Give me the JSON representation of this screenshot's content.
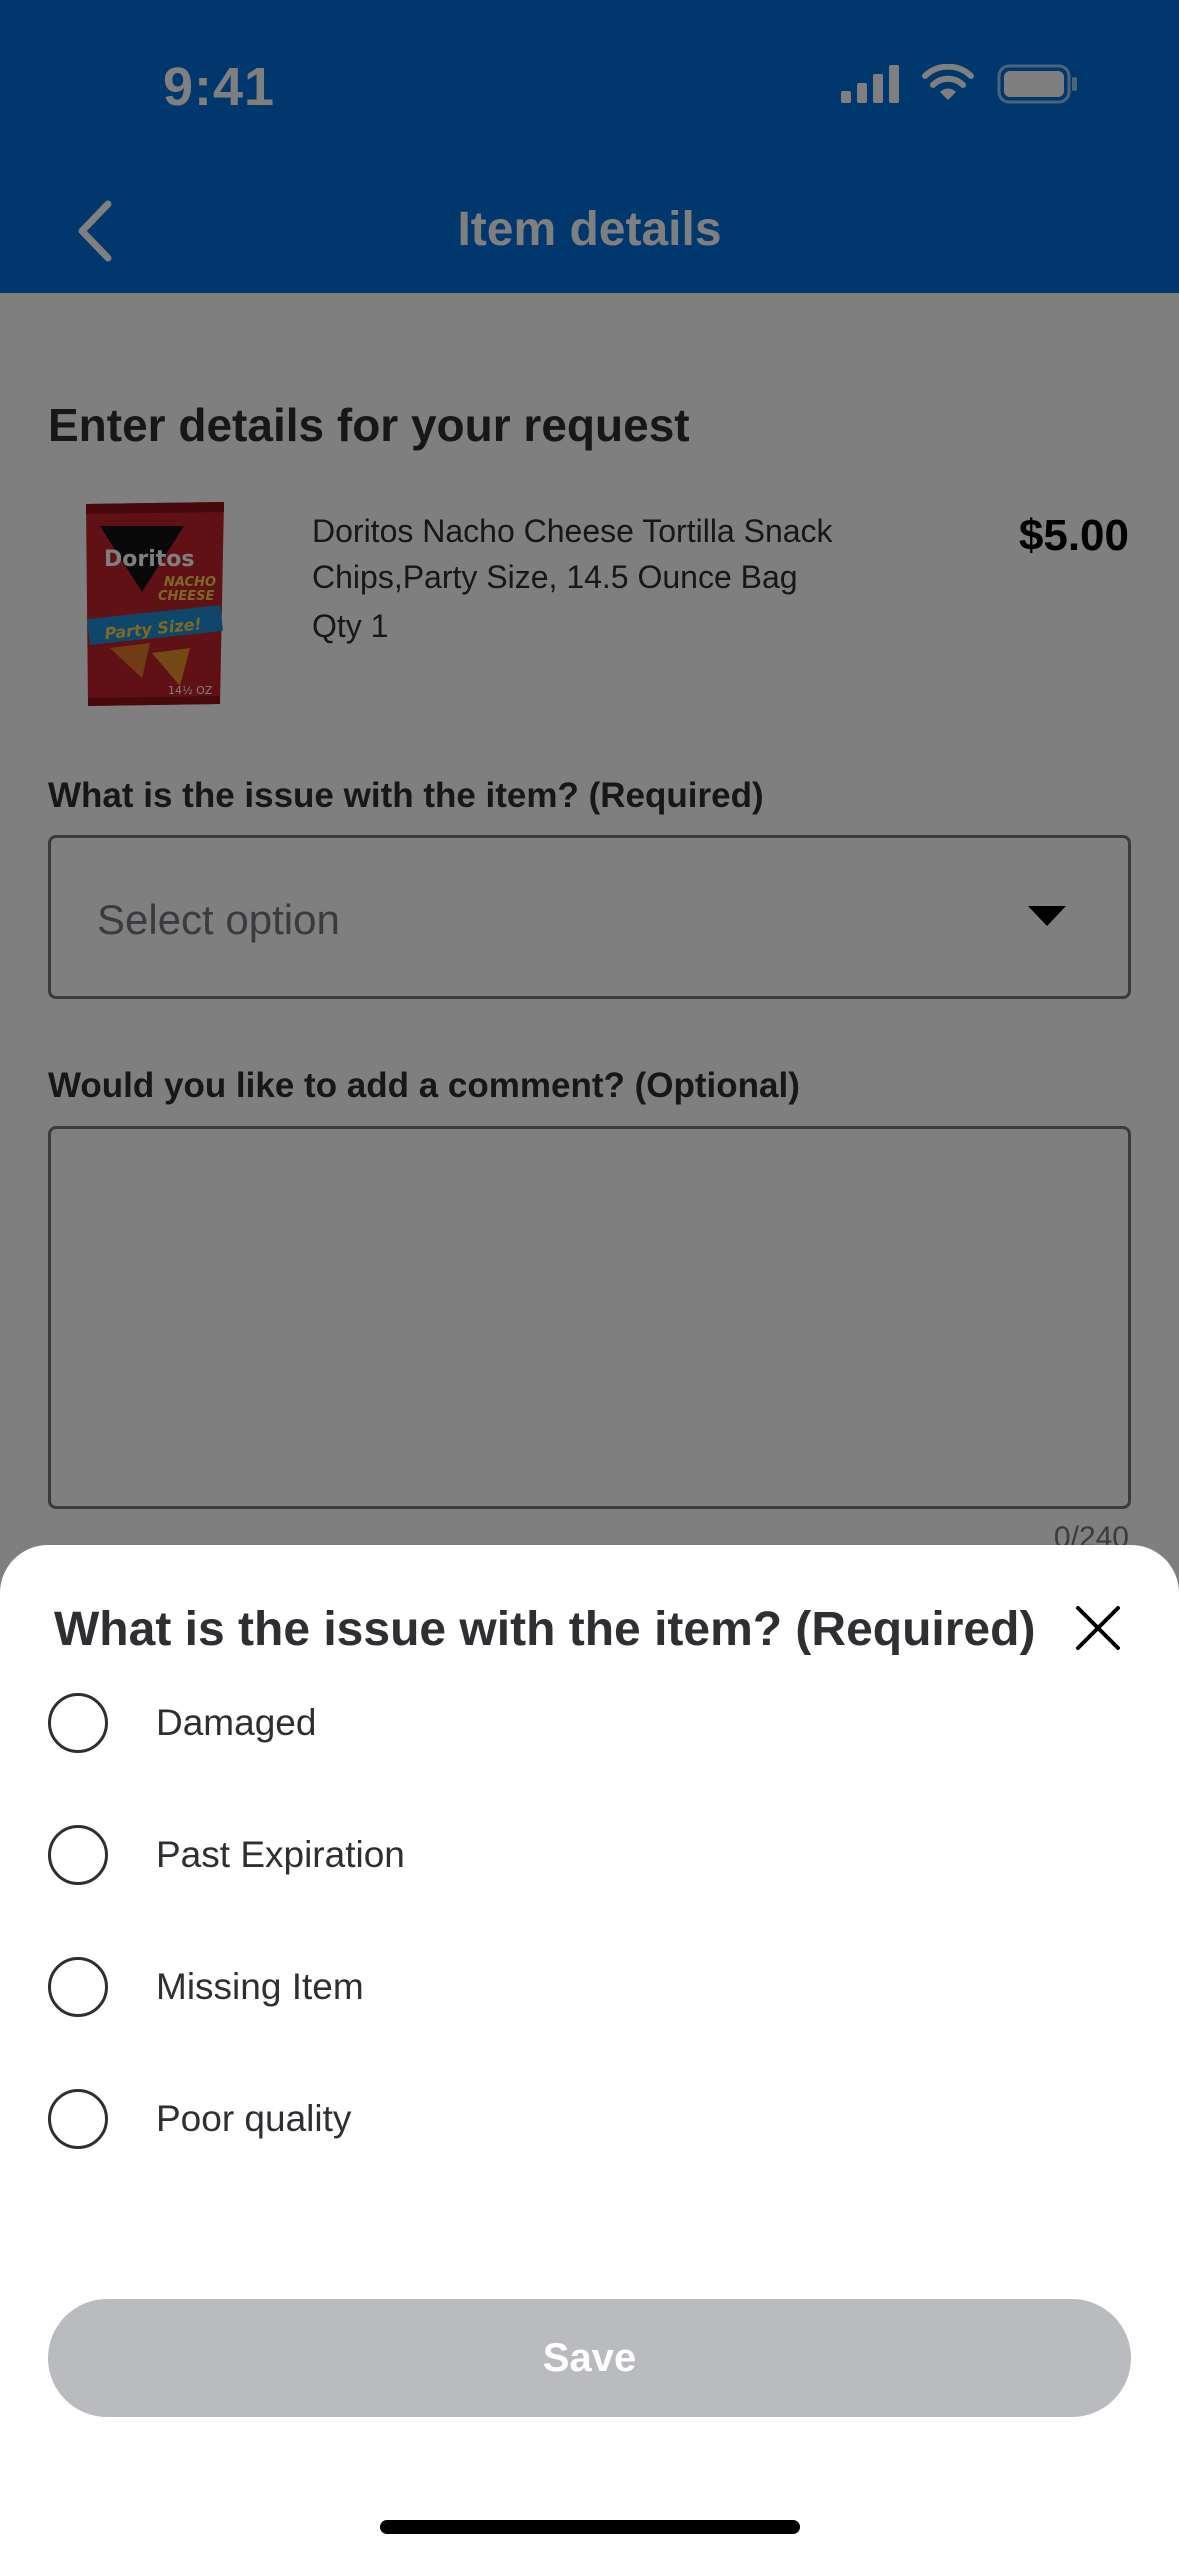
{
  "status_bar": {
    "time": "9:41"
  },
  "nav": {
    "title": "Item details"
  },
  "content": {
    "section_title": "Enter details for your request",
    "product": {
      "name": "Doritos Nacho Cheese Tortilla Snack Chips,Party Size, 14.5 Ounce Bag",
      "qty": "Qty 1",
      "price": "$5.00",
      "image": "doritos-bag",
      "bag_text": {
        "brand": "Doritos",
        "flavor_1": "NACHO",
        "flavor_2": "CHEESE",
        "size": "Party Size!",
        "weight": "14½ OZ"
      }
    },
    "issue_question": "What is the issue with the item? (Required)",
    "select_placeholder": "Select option",
    "comment_question": "Would you like to add a comment? (Optional)",
    "char_count": "0/240"
  },
  "sheet": {
    "title": "What is the issue with the item? (Required)",
    "options": [
      "Damaged",
      "Past Expiration",
      "Missing Item",
      "Poor quality"
    ],
    "save_label": "Save"
  },
  "colors": {
    "header_blue": "#0071dc",
    "save_disabled": "#babbbe",
    "overlay": "rgba(0,0,0,0.5)"
  },
  "icons": [
    "back-chevron-icon",
    "signal-icon",
    "wifi-icon",
    "battery-icon",
    "dropdown-caret-icon",
    "close-icon"
  ]
}
